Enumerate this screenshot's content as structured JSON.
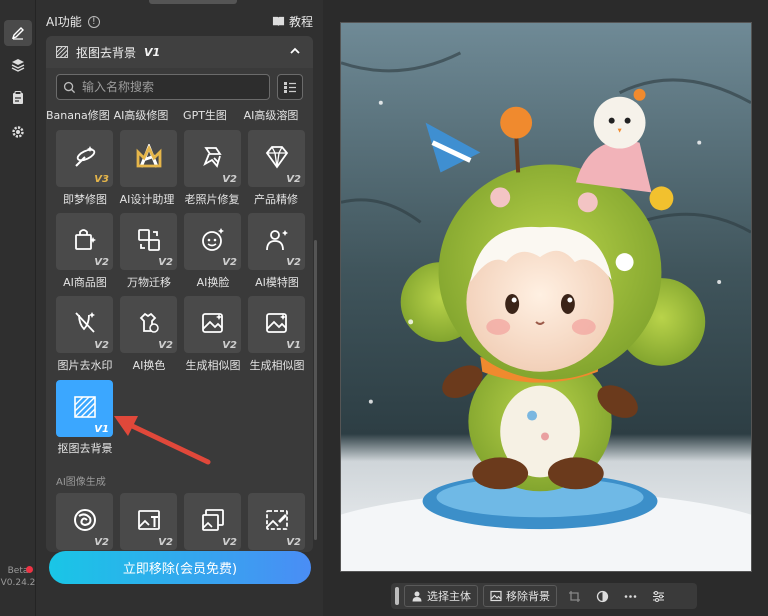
{
  "toolbar": {
    "tools": [
      "brush-icon",
      "layers-icon",
      "clipboard-icon",
      "settings-icon"
    ],
    "version_label": "Beta",
    "version_number": "V0.24.2"
  },
  "panel": {
    "title": "AI功能",
    "tutorial_label": "教程",
    "feature_header": {
      "label": "抠图去背景",
      "version": "V1"
    },
    "search_placeholder": "输入名称搜索",
    "top_row_labels": [
      "Banana修图",
      "AI高级修图",
      "GPT生图",
      "AI高级溶图"
    ],
    "rows": [
      [
        {
          "label": "即梦修图",
          "version": "V3",
          "icon": "magic-wand-icon",
          "gold": true
        },
        {
          "label": "AI设计助理",
          "version": "",
          "icon": "design-a-icon",
          "crown": true
        },
        {
          "label": "老照片修复",
          "version": "V2",
          "icon": "photo-repair-icon"
        },
        {
          "label": "产品精修",
          "version": "V2",
          "icon": "diamond-icon"
        }
      ],
      [
        {
          "label": "AI商品图",
          "version": "V2",
          "icon": "shopping-bag-icon"
        },
        {
          "label": "万物迁移",
          "version": "V2",
          "icon": "transfer-icon"
        },
        {
          "label": "AI换脸",
          "version": "V2",
          "icon": "face-swap-icon"
        },
        {
          "label": "AI模特图",
          "version": "V2",
          "icon": "model-icon"
        }
      ],
      [
        {
          "label": "图片去水印",
          "version": "V2",
          "icon": "watermark-remove-icon"
        },
        {
          "label": "AI换色",
          "version": "V2",
          "icon": "recolor-icon"
        },
        {
          "label": "生成相似图",
          "version": "V2",
          "icon": "similar-image-icon"
        },
        {
          "label": "生成相似图",
          "version": "V1",
          "icon": "similar-image-icon"
        }
      ],
      [
        {
          "label": "抠图去背景",
          "version": "V1",
          "icon": "cutout-icon",
          "selected": true
        }
      ]
    ],
    "section_label": "AI图像生成",
    "gen_row": [
      {
        "version": "V2",
        "icon": "swirl-icon"
      },
      {
        "version": "V2",
        "icon": "image-text-icon"
      },
      {
        "version": "V2",
        "icon": "image-frame-icon"
      },
      {
        "version": "V2",
        "icon": "image-edit-icon"
      }
    ],
    "cta_label": "立即移除(会员免费)"
  },
  "image_toolbar": {
    "select_subject": "选择主体",
    "remove_background": "移除背景"
  },
  "colors": {
    "accent_blue": "#3ba7ff",
    "cta_start": "#19c6e6",
    "cta_end": "#4a8df5",
    "arrow_red": "#e0483a"
  }
}
